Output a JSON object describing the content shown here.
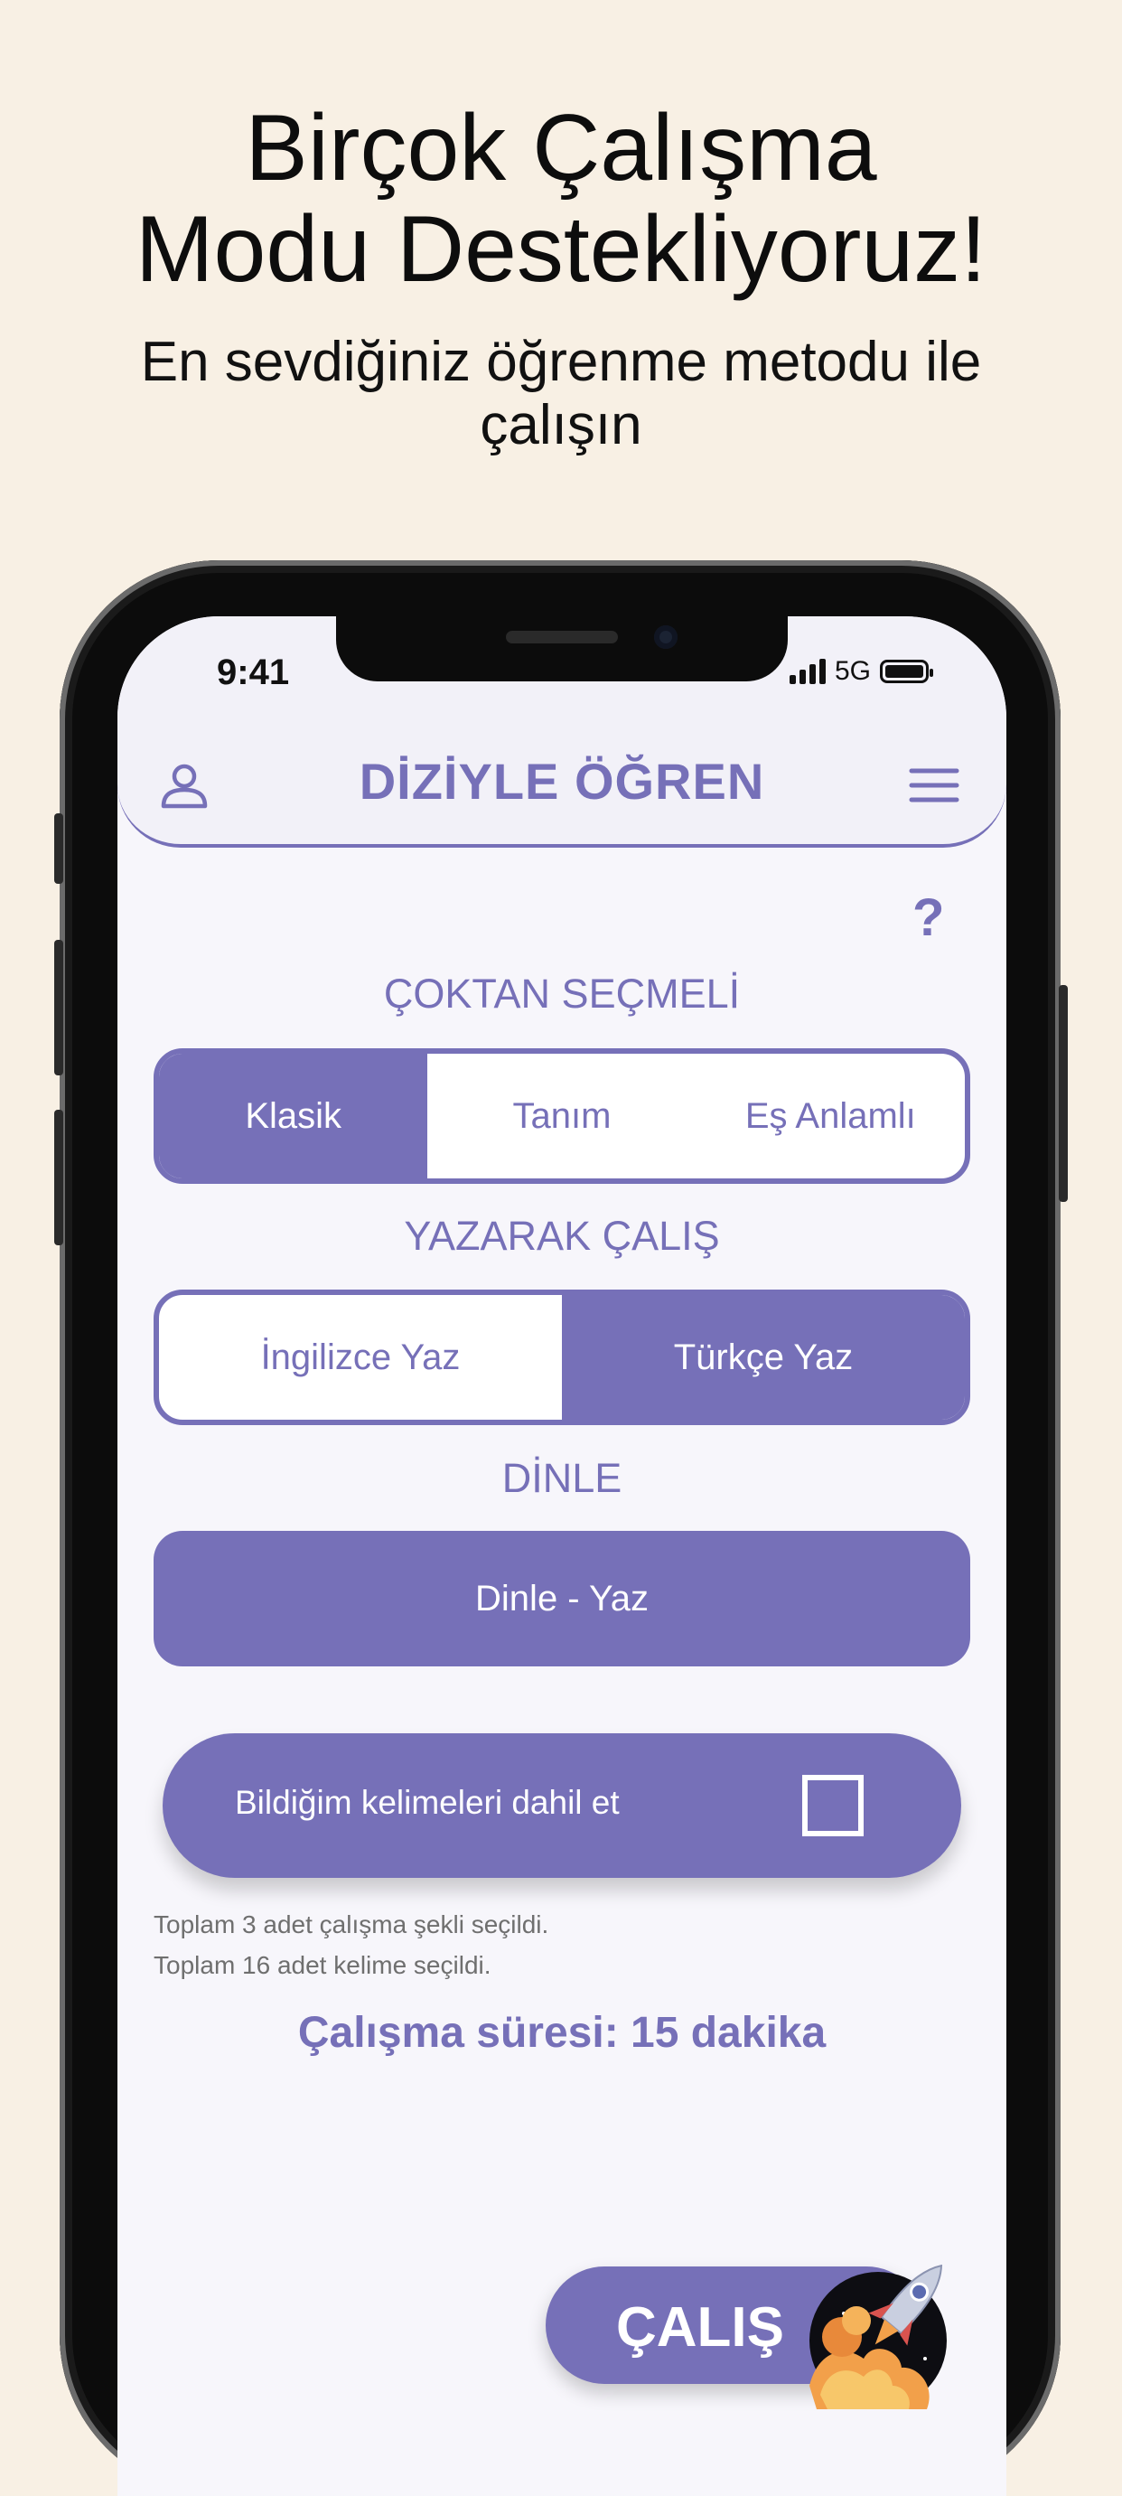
{
  "promo": {
    "headline_line1": "Birçok Çalışma",
    "headline_line2": "Modu Destekliyoruz!",
    "subheadline_line1": "En sevdiğiniz öğrenme metodu ile",
    "subheadline_line2": "çalışın"
  },
  "status_bar": {
    "time": "9:41",
    "network": "5G"
  },
  "header": {
    "title": "DİZİYLE ÖĞREN",
    "left_icon": "user-icon",
    "right_icon": "menu-icon"
  },
  "help": {
    "label": "?"
  },
  "multiple_choice": {
    "title": "ÇOKTAN SEÇMELİ",
    "options": [
      "Klasik",
      "Tanım",
      "Eş Anlamlı"
    ],
    "selected": "Klasik"
  },
  "writing": {
    "title": "YAZARAK ÇALIŞ",
    "options": [
      "İngilizce Yaz",
      "Türkçe Yaz"
    ],
    "selected": "Türkçe Yaz"
  },
  "listening": {
    "title": "DİNLE",
    "button_label": "Dinle - Yaz"
  },
  "include_known": {
    "label": "Bildiğim kelimeleri dahil et",
    "checked": false
  },
  "summary": {
    "modes_text": "Toplam 3 adet çalışma şekli seçildi.",
    "words_text": "Toplam 16 adet kelime seçildi.",
    "duration_text": "Çalışma süresi: 15 dakika"
  },
  "start": {
    "label": "ÇALIŞ",
    "icon": "rocket-icon"
  },
  "colors": {
    "background": "#f8f0e4",
    "accent": "#7670b8",
    "screen": "#f7f6fb"
  }
}
